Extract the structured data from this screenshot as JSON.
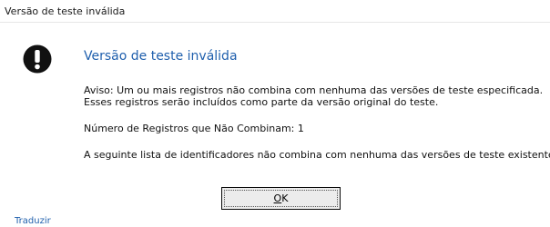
{
  "window": {
    "title": "Versão de teste inválida"
  },
  "dialog": {
    "icon": "error-exclamation-icon",
    "heading": "Versão de teste inválida",
    "message_line1": "Aviso: Um ou mais registros não combina com nenhuma das versões de teste especificada.",
    "message_line2": "Esses registros serão incluídos como parte da versão original do teste.",
    "mismatch_count": "Número de Registros que Não Combinam: 1",
    "list_intro": "A seguinte lista de identificadores não combina com nenhuma das versões de teste existente:"
  },
  "buttons": {
    "ok_mnemonic": "O",
    "ok_rest": "K"
  },
  "footer": {
    "translate_link": "Traduzir"
  },
  "colors": {
    "heading": "#1f5fad",
    "link": "#1f5fad"
  }
}
